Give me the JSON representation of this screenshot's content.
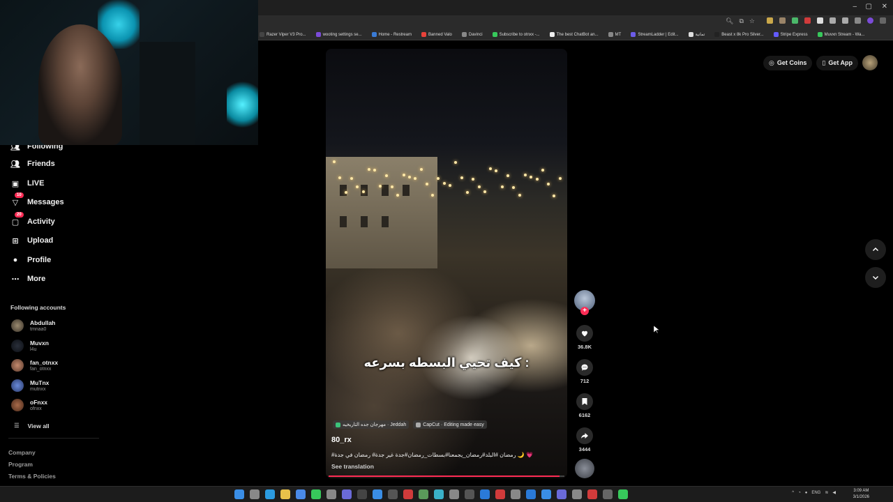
{
  "browser": {
    "bookmarks": [
      {
        "label": "Razer Viper V3 Pro...",
        "color": "#444"
      },
      {
        "label": "wooting settings se...",
        "color": "#7b4bd8"
      },
      {
        "label": "Home - Restream",
        "color": "#3a7bd5"
      },
      {
        "label": "Banned Valo",
        "color": "#e8423a"
      },
      {
        "label": "Davinci",
        "color": "#888"
      },
      {
        "label": "Subscribe to otnxx -...",
        "color": "#37c85b"
      },
      {
        "label": "The best ChatBot an...",
        "color": "#eee"
      },
      {
        "label": "MT",
        "color": "#888"
      },
      {
        "label": "StreamLadder | Edit...",
        "color": "#6c5ce7"
      },
      {
        "label": "تمانية",
        "color": "#ddd"
      },
      {
        "label": "Beast x 8k Pro Silver...",
        "color": "#222"
      },
      {
        "label": "Stripe Express",
        "color": "#635bff"
      },
      {
        "label": "Muvxn Stream - Wa...",
        "color": "#37c85b"
      }
    ]
  },
  "sidebar": {
    "nav": [
      {
        "label": "Following",
        "icon": "following-icon",
        "badge": ""
      },
      {
        "label": "Friends",
        "icon": "friends-icon",
        "badge": ""
      },
      {
        "label": "LIVE",
        "icon": "live-icon",
        "badge": ""
      },
      {
        "label": "Messages",
        "icon": "messages-icon",
        "badge": "10"
      },
      {
        "label": "Activity",
        "icon": "activity-icon",
        "badge": "20"
      },
      {
        "label": "Upload",
        "icon": "upload-icon",
        "badge": ""
      },
      {
        "label": "Profile",
        "icon": "profile-icon",
        "badge": ""
      },
      {
        "label": "More",
        "icon": "more-icon",
        "badge": ""
      }
    ],
    "following_title": "Following accounts",
    "accounts": [
      {
        "name": "Abdullah",
        "handle": "tmnaa0"
      },
      {
        "name": "Muvxn",
        "handle": "l4u"
      },
      {
        "name": "fan_otnxx",
        "handle": "fan_otnxx"
      },
      {
        "name": "MuTnx",
        "handle": "mutnxx"
      },
      {
        "name": "oFnxx",
        "handle": "ofnxx"
      }
    ],
    "view_all": "View all",
    "footer": [
      "Company",
      "Program",
      "Terms & Policies"
    ]
  },
  "video": {
    "caption_overlay": "كيف تحيي البسطه بسرعه :",
    "location_tag": "مهرجان جده التاريخيه · Jeddah",
    "capcut_tag": "CapCut · Editing made easy",
    "author": "80_rx",
    "description": "#رمضان #البلد#رمضان_يجمعنا#بسطات_رمضان#جدة غير جدة# رمضان في جدة 🌙 💗",
    "see_translation": "See translation",
    "progress_percent": 98
  },
  "actions": {
    "likes": "36.8K",
    "comments": "712",
    "saves": "6162",
    "shares": "3444"
  },
  "topbar": {
    "get_coins": "Get Coins",
    "get_app": "Get App"
  },
  "taskbar": {
    "lang": "ENG",
    "time": "3:09 AM",
    "date": "3/1/2026"
  }
}
